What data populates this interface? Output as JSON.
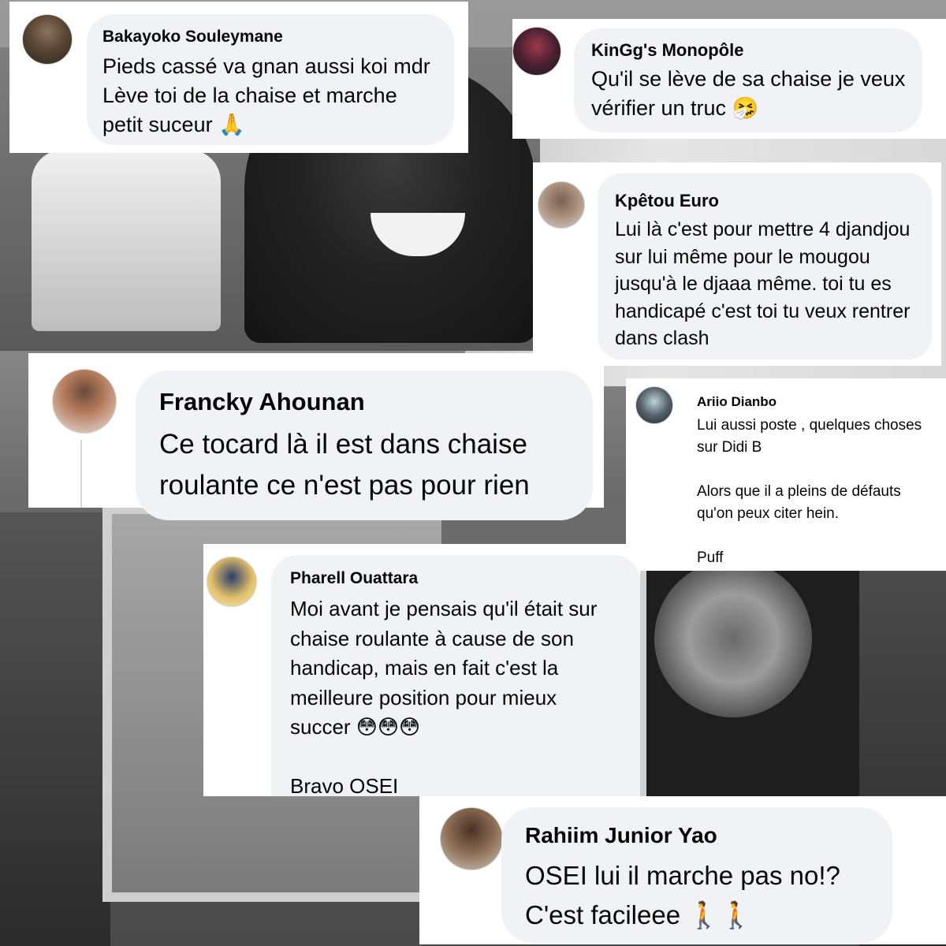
{
  "comments": [
    {
      "author": "Bakayoko Souleymane",
      "text": "Pieds cassé va gnan aussi koi mdr\nLève toi de la chaise et marche\npetit suceur 🙏",
      "avatar_icon": "user-avatar-icon"
    },
    {
      "author": "KinGg's Monopôle",
      "text": "Qu'il se lève de sa chaise je veux\nvérifier un truc 🤧",
      "avatar_icon": "user-avatar-icon"
    },
    {
      "author": "Kpêtou Euro",
      "text": "Lui là c'est pour mettre 4 djandjou\nsur lui même pour le mougou\njusqu'à le djaaa même. toi tu es\nhandicapé c'est toi tu veux rentrer\ndans clash",
      "avatar_icon": "user-avatar-icon"
    },
    {
      "author": "Francky Ahounan",
      "text": "Ce tocard là il est dans chaise\nroulante ce n'est pas pour rien",
      "avatar_icon": "user-avatar-icon"
    },
    {
      "author": "Ariio Dianbo",
      "text": "Lui aussi poste , quelques choses\nsur Didi B\n\nAlors que il a pleins de défauts\nqu'on peux citer hein.\n\nPuff",
      "avatar_icon": "user-avatar-icon"
    },
    {
      "author": "Pharell Ouattara",
      "text": "Moi avant je pensais qu'il était sur\nchaise roulante à cause de son\nhandicap, mais en fait c'est la\nmeilleure position pour mieux\nsuccer 😳😳😳\n\nBravo OSEI",
      "avatar_icon": "user-avatar-icon"
    },
    {
      "author": "Rahiim Junior Yao",
      "text": "OSEI lui il marche pas no!?\nC'est facileee 🚶🚶",
      "avatar_icon": "user-avatar-icon"
    }
  ]
}
